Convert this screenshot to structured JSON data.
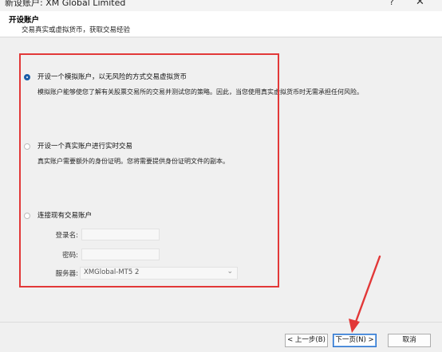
{
  "window": {
    "title": "新设账户: XM Global Limited",
    "help_glyph": "?",
    "close_glyph": "✕"
  },
  "header": {
    "title": "开设账户",
    "subtitle": "交易真实或虚拟货币，获取交易经验"
  },
  "options": [
    {
      "label": "开设一个模拟账户，以无风险的方式交易虚拟货币",
      "description": "模拟账户能够使您了解有关股票交易所的交易并测试您的策略。因此，当您使用真实虚拟货币时无需承担任何风险。",
      "checked": true
    },
    {
      "label": "开设一个真实账户进行实时交易",
      "description": "真实账户需要额外的身份证明。您将需要提供身份证明文件的副本。",
      "checked": false
    },
    {
      "label": "连接现有交易账户",
      "checked": false
    }
  ],
  "existing_account": {
    "login_label": "登录名:",
    "login_value": "",
    "password_label": "密码:",
    "password_value": "",
    "server_label": "服务器:",
    "server_value": "XMGlobal-MT5 2"
  },
  "footer": {
    "back_label": "< 上一步(B)",
    "next_label": "下一页(N) >",
    "cancel_label": "取消"
  },
  "colors": {
    "highlight_box": "#e23838",
    "annotation_arrow": "#e23838",
    "radio_checked": "#1a5ea8"
  }
}
